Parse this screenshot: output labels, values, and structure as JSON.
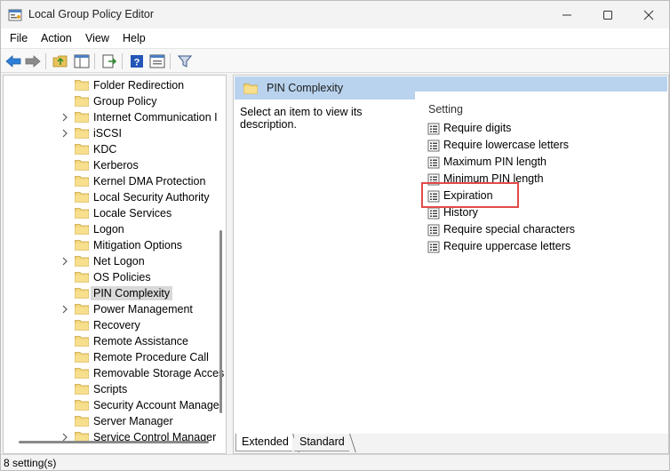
{
  "window": {
    "title": "Local Group Policy Editor",
    "accent": "#b9d3ee"
  },
  "menu": {
    "items": [
      "File",
      "Action",
      "View",
      "Help"
    ]
  },
  "toolbar": {
    "icons": [
      "back-icon",
      "forward-icon",
      "up-folder-icon",
      "show-hide-tree-icon",
      "export-list-icon",
      "help-icon",
      "properties-icon",
      "filter-icon"
    ]
  },
  "tree": {
    "items": [
      {
        "label": "Folder Redirection",
        "expandable": false
      },
      {
        "label": "Group Policy",
        "expandable": false
      },
      {
        "label": "Internet Communication I",
        "expandable": true
      },
      {
        "label": "iSCSI",
        "expandable": true
      },
      {
        "label": "KDC",
        "expandable": false
      },
      {
        "label": "Kerberos",
        "expandable": false
      },
      {
        "label": "Kernel DMA Protection",
        "expandable": false
      },
      {
        "label": "Local Security Authority",
        "expandable": false
      },
      {
        "label": "Locale Services",
        "expandable": false
      },
      {
        "label": "Logon",
        "expandable": false
      },
      {
        "label": "Mitigation Options",
        "expandable": false
      },
      {
        "label": "Net Logon",
        "expandable": true
      },
      {
        "label": "OS Policies",
        "expandable": false
      },
      {
        "label": "PIN Complexity",
        "expandable": false,
        "selected": true
      },
      {
        "label": "Power Management",
        "expandable": true
      },
      {
        "label": "Recovery",
        "expandable": false
      },
      {
        "label": "Remote Assistance",
        "expandable": false
      },
      {
        "label": "Remote Procedure Call",
        "expandable": false
      },
      {
        "label": "Removable Storage Acces",
        "expandable": false
      },
      {
        "label": "Scripts",
        "expandable": false
      },
      {
        "label": "Security Account Manage",
        "expandable": false
      },
      {
        "label": "Server Manager",
        "expandable": false
      },
      {
        "label": "Service Control Manager",
        "expandable": true
      }
    ]
  },
  "details": {
    "header_title": "PIN Complexity",
    "description": "Select an item to view its description.",
    "column_header": "Setting",
    "settings": [
      "Require digits",
      "Require lowercase letters",
      "Maximum PIN length",
      "Minimum PIN length",
      "Expiration",
      "History",
      "Require special characters",
      "Require uppercase letters"
    ],
    "highlighted_setting": "Expiration",
    "highlight_color": "#e24a4a"
  },
  "tabs": {
    "extended": "Extended",
    "standard": "Standard",
    "active": "Extended"
  },
  "status": {
    "text": "8 setting(s)"
  }
}
